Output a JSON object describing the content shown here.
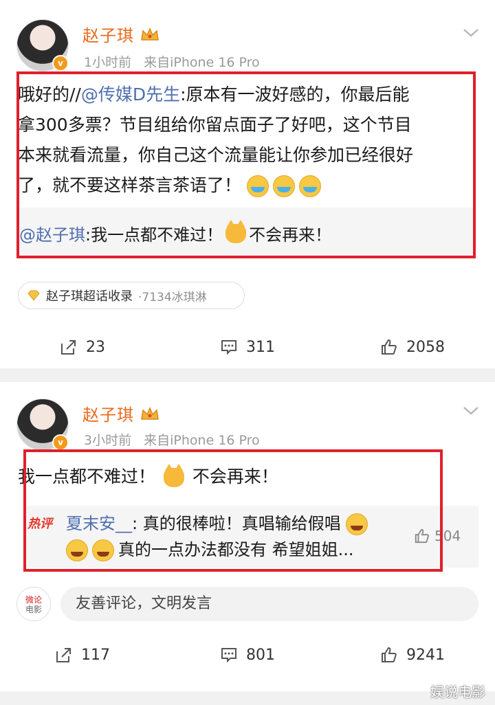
{
  "post1": {
    "user_name": "赵子琪",
    "time": "1小时前",
    "source": "来自iPhone 16 Pro",
    "text_prefix": "哦好的//",
    "mention": "@传媒D先生",
    "text_line1_rest": ":原本有一波好感的，你最后能",
    "text_line2": "拿300多票？节目组给你留点面子了好吧，这个节目",
    "text_line3": "本来就看流量，你自己这个流量能让你参加已经很好",
    "text_line4": "了，就不要这样茶言茶语了！",
    "quote_mention": "@赵子琪",
    "quote_text1": ":我一点都不难过！",
    "quote_text2": "不会再来！",
    "topic_label": "赵子琪超话收录",
    "topic_sub": "·7134冰琪淋",
    "repost_count": "23",
    "comment_count": "311",
    "like_count": "2058"
  },
  "post2": {
    "user_name": "赵子琪",
    "time": "3小时前",
    "source": "来自iPhone 16 Pro",
    "text1": "我一点都不难过！",
    "text2": "不会再来！",
    "hot_tag": "热评",
    "hot_user": "夏末安__",
    "hot_line1": ": 真的很棒啦！真唱输给假唱",
    "hot_line2": "真的一点办法都没有  希望姐姐...",
    "hot_likes": "504",
    "comment_placeholder": "友善评论，文明发言",
    "logo_text_1": "微论",
    "logo_text_2": "电影",
    "repost_count": "117",
    "comment_count": "801",
    "like_count": "9241"
  },
  "watermark": "娱说电影",
  "icons": [
    "crown-icon",
    "chevron-down-icon",
    "repost-icon",
    "comment-icon",
    "like-icon",
    "diamond-icon",
    "verified-badge-icon"
  ],
  "colors": {
    "name": "#e86a1c",
    "mention": "#4e6fb0",
    "highlight_box": "#e0202c",
    "verified": "#f29a1b"
  }
}
